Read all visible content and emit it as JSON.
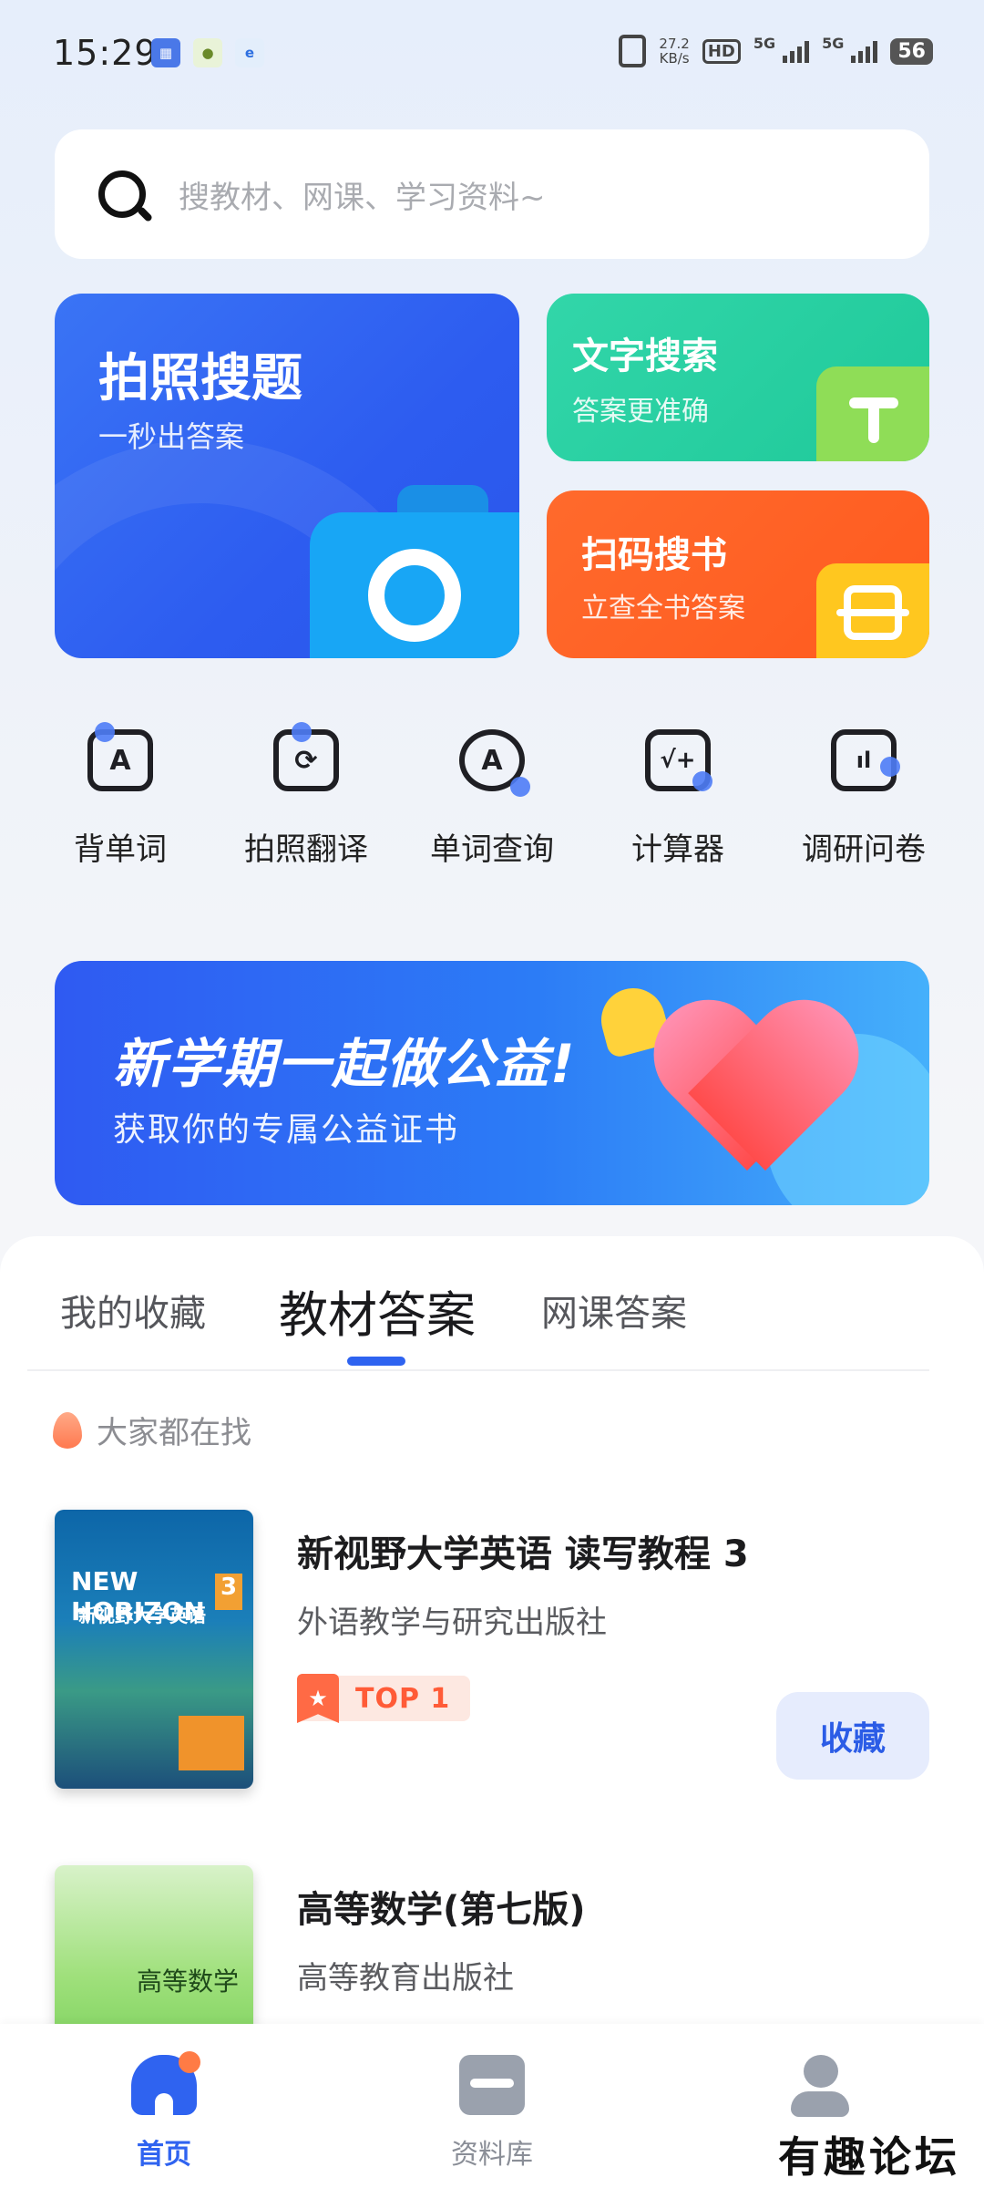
{
  "status_bar": {
    "time": "15:29",
    "net_speed_value": "27.2",
    "net_speed_unit": "KB/s",
    "hd_label": "HD",
    "signal_label_1": "5G",
    "signal_label_2": "5G",
    "battery": "56"
  },
  "search": {
    "placeholder": "搜教材、网课、学习资料~"
  },
  "features": {
    "photo": {
      "title": "拍照搜题",
      "subtitle": "一秒出答案"
    },
    "text": {
      "title": "文字搜索",
      "subtitle": "答案更准确"
    },
    "scan": {
      "title": "扫码搜书",
      "subtitle": "立查全书答案"
    }
  },
  "tools": [
    {
      "label": "背单词",
      "icon": "flashcard-icon"
    },
    {
      "label": "拍照翻译",
      "icon": "photo-translate-icon"
    },
    {
      "label": "单词查询",
      "icon": "word-lookup-icon"
    },
    {
      "label": "计算器",
      "icon": "calculator-icon"
    },
    {
      "label": "调研问卷",
      "icon": "survey-icon"
    }
  ],
  "banner": {
    "title": "新学期一起做公益!",
    "subtitle": "获取你的专属公益证书"
  },
  "tabs": [
    {
      "label": "我的收藏",
      "active": false
    },
    {
      "label": "教材答案",
      "active": true
    },
    {
      "label": "网课答案",
      "active": false
    }
  ],
  "hot_section": {
    "label": "大家都在找"
  },
  "books": [
    {
      "title": "新视野大学英语 读写教程 3",
      "publisher": "外语教学与研究出版社",
      "rank_badge": "TOP 1",
      "action": "收藏",
      "cover_text_1": "NEW HORIZON",
      "cover_text_2": "新视野大学英语",
      "cover_volume": "3"
    },
    {
      "title": "高等数学(第七版)",
      "publisher": "高等教育出版社",
      "cover_text_1": "高等数学"
    }
  ],
  "bottom_nav": [
    {
      "label": "首页",
      "active": true,
      "icon": "home-icon"
    },
    {
      "label": "资料库",
      "active": false,
      "icon": "folder-icon"
    },
    {
      "label": "",
      "active": false,
      "icon": "user-icon"
    }
  ],
  "watermark": "有趣论坛",
  "colors": {
    "accent": "#2f63f0",
    "photo_card": "#2d5cf0",
    "text_card": "#1fc99a",
    "scan_card": "#ff5a1f",
    "badge_red": "#ff5b37"
  }
}
